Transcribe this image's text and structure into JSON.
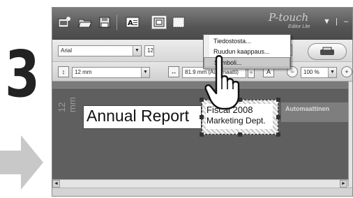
{
  "step": {
    "number": "3"
  },
  "app": {
    "brand": "P-touch",
    "brand_sub": "Editor Lite",
    "window_controls": {
      "dropdown": "▼",
      "separator": "|",
      "minimize": "–"
    }
  },
  "toolbar": {
    "font_name": "Arial",
    "font_size": "12",
    "height_value": "12 mm",
    "length_value": "81.9 mm (Automaatti)",
    "zoom_value": "100 %",
    "format_labels": {
      "italic": "A",
      "outline": "A"
    }
  },
  "menu": {
    "items": [
      {
        "label": "Tiedostosta...",
        "highlighted": false
      },
      {
        "label": "Ruudun kaappaus...",
        "highlighted": false
      },
      {
        "label": "Symboli...",
        "highlighted": true
      }
    ]
  },
  "canvas": {
    "tape_width_label": "12 mm",
    "label_text": "Annual Report",
    "selected_text_line1": "Fiscal 2008",
    "selected_text_line2": "Marketing Dept.",
    "auto_tag": "Automaattinen"
  },
  "icons": [
    "new-icon",
    "open-icon",
    "save-icon",
    "text-icon",
    "frame-icon",
    "image-icon",
    "hand-cursor-icon",
    "arrow-right-icon"
  ],
  "colors": {
    "titlebar": "#555555",
    "canvas": "#5f5f5f",
    "menu_highlight": "#c9c9c9",
    "arrow": "#c8c8c8",
    "step_number": "#222222"
  }
}
